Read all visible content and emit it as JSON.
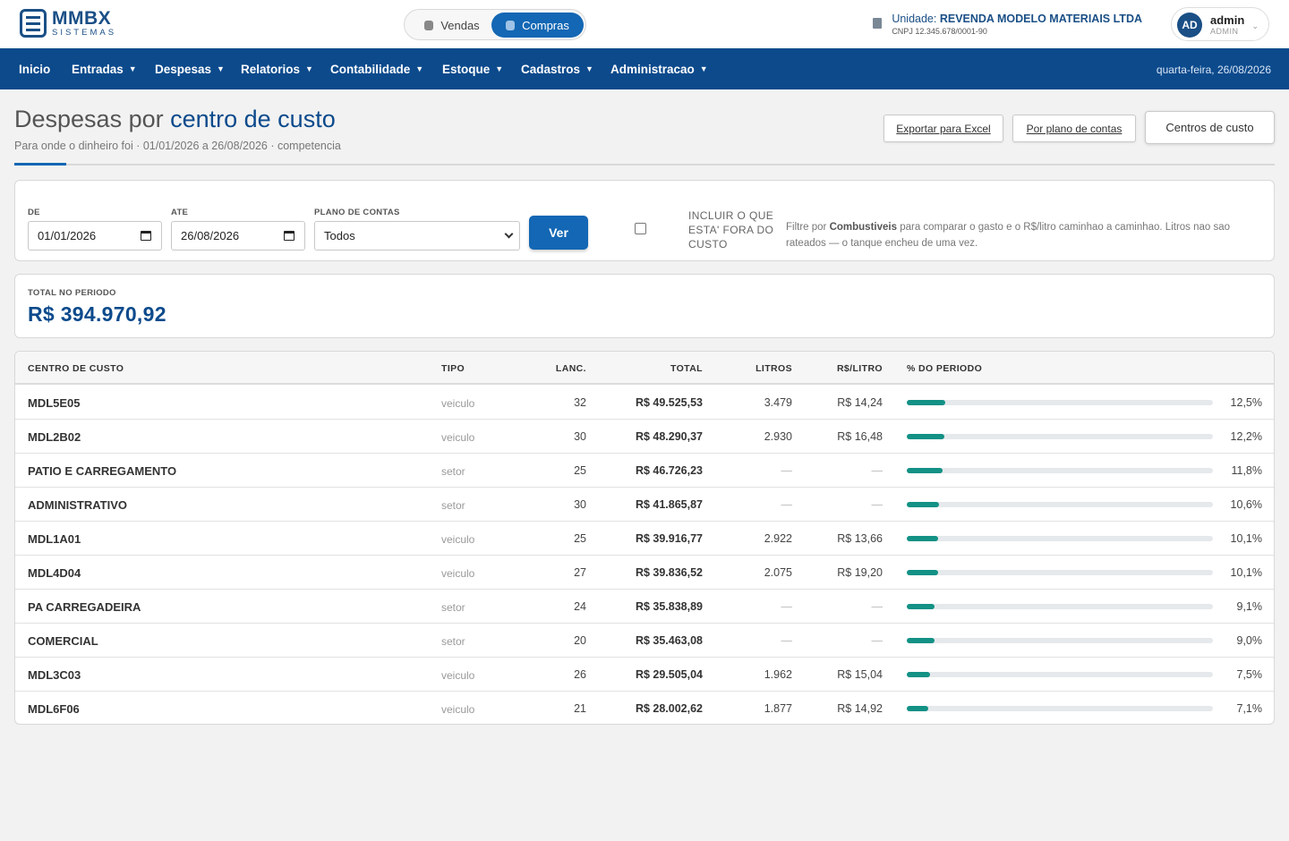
{
  "brand": {
    "name": "MMBX",
    "tagline": "SISTEMAS"
  },
  "mode_switch": {
    "options": [
      "Vendas",
      "Compras"
    ],
    "active": "Compras"
  },
  "unit": {
    "label": "Unidade:",
    "name": "REVENDA MODELO MATERIAIS LTDA",
    "cnpj": "CNPJ 12.345.678/0001-90"
  },
  "user": {
    "initials": "AD",
    "name": "admin",
    "role": "ADMIN"
  },
  "nav": {
    "items": [
      {
        "label": "Inicio",
        "has_menu": false
      },
      {
        "label": "Entradas",
        "has_menu": true
      },
      {
        "label": "Despesas",
        "has_menu": true
      },
      {
        "label": "Relatorios",
        "has_menu": true
      },
      {
        "label": "Contabilidade",
        "has_menu": true
      },
      {
        "label": "Estoque",
        "has_menu": true
      },
      {
        "label": "Cadastros",
        "has_menu": true
      },
      {
        "label": "Administracao",
        "has_menu": true
      }
    ],
    "date": "quarta-feira, 26/08/2026",
    "caret": "▼"
  },
  "page": {
    "title_prefix": "Despesas por",
    "title_strong": "centro de custo",
    "subtitle": "Para onde o dinheiro foi · 01/01/2026 a 26/08/2026 · competencia",
    "actions": {
      "export": "Exportar para Excel",
      "by_plan": "Por plano de contas",
      "cost_centers": "Centros de custo"
    }
  },
  "filters": {
    "from_label": "DE",
    "from_value": "01/01/2026",
    "to_label": "ATE",
    "to_value": "26/08/2026",
    "plan_label": "PLANO DE CONTAS",
    "plan_value": "Todos",
    "submit": "Ver",
    "include_outside_label": "INCLUIR O QUE ESTA' FORA DO CUSTO",
    "include_outside_checked": false,
    "hint_before": "Filtre por",
    "hint_strong": "Combustiveis",
    "hint_after": "para comparar o gasto e o R$/litro caminhao a caminhao. Litros nao sao rateados — o tanque encheu de uma vez."
  },
  "summary": {
    "label": "TOTAL NO PERIODO",
    "value": "R$ 394.970,92"
  },
  "table": {
    "columns": [
      "CENTRO DE CUSTO",
      "TIPO",
      "LANC.",
      "TOTAL",
      "LITROS",
      "R$/LITRO",
      "% DO PERIODO"
    ],
    "rows": [
      {
        "name": "MDL5E05",
        "tipo": "veiculo",
        "lanc": "32",
        "total": "R$ 49.525,53",
        "litros": "3.479",
        "rpl": "R$ 14,24",
        "pct": "12,5%",
        "share": 12.5
      },
      {
        "name": "MDL2B02",
        "tipo": "veiculo",
        "lanc": "30",
        "total": "R$ 48.290,37",
        "litros": "2.930",
        "rpl": "R$ 16,48",
        "pct": "12,2%",
        "share": 12.2
      },
      {
        "name": "PATIO E CARREGAMENTO",
        "tipo": "setor",
        "lanc": "25",
        "total": "R$ 46.726,23",
        "litros": "—",
        "rpl": "—",
        "pct": "11,8%",
        "share": 11.8
      },
      {
        "name": "ADMINISTRATIVO",
        "tipo": "setor",
        "lanc": "30",
        "total": "R$ 41.865,87",
        "litros": "—",
        "rpl": "—",
        "pct": "10,6%",
        "share": 10.6
      },
      {
        "name": "MDL1A01",
        "tipo": "veiculo",
        "lanc": "25",
        "total": "R$ 39.916,77",
        "litros": "2.922",
        "rpl": "R$ 13,66",
        "pct": "10,1%",
        "share": 10.1
      },
      {
        "name": "MDL4D04",
        "tipo": "veiculo",
        "lanc": "27",
        "total": "R$ 39.836,52",
        "litros": "2.075",
        "rpl": "R$ 19,20",
        "pct": "10,1%",
        "share": 10.1
      },
      {
        "name": "PA CARREGADEIRA",
        "tipo": "setor",
        "lanc": "24",
        "total": "R$ 35.838,89",
        "litros": "—",
        "rpl": "—",
        "pct": "9,1%",
        "share": 9.1
      },
      {
        "name": "COMERCIAL",
        "tipo": "setor",
        "lanc": "20",
        "total": "R$ 35.463,08",
        "litros": "—",
        "rpl": "—",
        "pct": "9,0%",
        "share": 9.0
      },
      {
        "name": "MDL3C03",
        "tipo": "veiculo",
        "lanc": "26",
        "total": "R$ 29.505,04",
        "litros": "1.962",
        "rpl": "R$ 15,04",
        "pct": "7,5%",
        "share": 7.5
      },
      {
        "name": "MDL6F06",
        "tipo": "veiculo",
        "lanc": "21",
        "total": "R$ 28.002,62",
        "litros": "1.877",
        "rpl": "R$ 14,92",
        "pct": "7,1%",
        "share": 7.1
      }
    ]
  },
  "colors": {
    "brand_blue": "#0c4a8c",
    "accent_blue": "#1367b4",
    "bar_fill": "#139185",
    "bar_track": "#e6e9ec"
  }
}
